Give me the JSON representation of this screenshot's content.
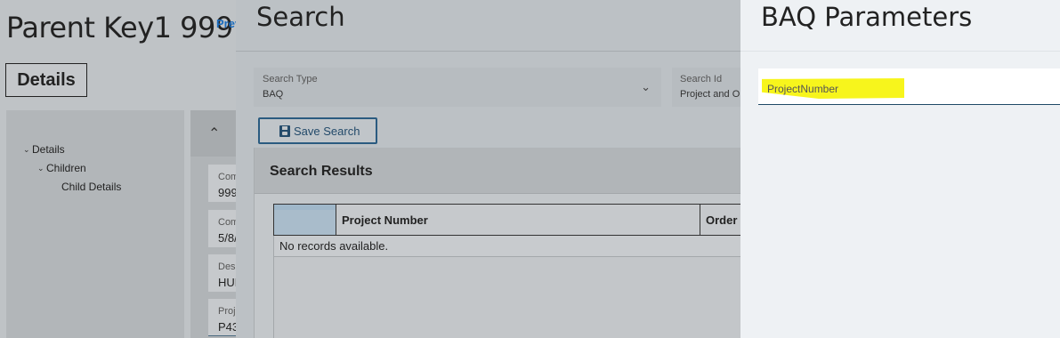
{
  "page": {
    "title": "Parent Key1 999",
    "prev_link": "Prev",
    "details_tab": "Details",
    "tree": [
      {
        "label": "Details",
        "expanded": true
      },
      {
        "label": "Children",
        "expanded": true
      },
      {
        "label": "Child Details"
      }
    ],
    "fields": [
      {
        "label": "Com",
        "value": "999"
      },
      {
        "label": "Com",
        "value": "5/8/"
      },
      {
        "label": "Desi",
        "value": "HUN"
      },
      {
        "label": "Proj",
        "value": "P43"
      }
    ]
  },
  "search": {
    "title": "Search",
    "search_type": {
      "label": "Search Type",
      "value": "BAQ"
    },
    "search_id": {
      "label": "Search Id",
      "value": "Project and O"
    },
    "save_button": "Save Search",
    "results": {
      "title": "Search Results",
      "columns": [
        "",
        "Project Number",
        "Order N"
      ],
      "empty_message": "No records available."
    }
  },
  "baq": {
    "title": "BAQ Parameters",
    "parameter_label": "ProjectNumber",
    "highlight_color": "#f7f51c"
  }
}
